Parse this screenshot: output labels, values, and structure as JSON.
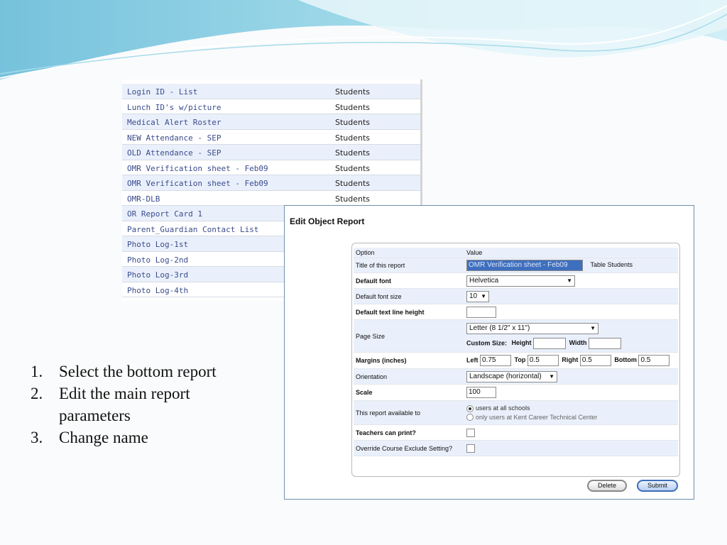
{
  "report_list": {
    "rows": [
      {
        "name": "Login ID - List",
        "category": "Students"
      },
      {
        "name": "Lunch ID's w/picture",
        "category": "Students"
      },
      {
        "name": "Medical Alert Roster",
        "category": "Students"
      },
      {
        "name": "NEW Attendance - SEP",
        "category": "Students"
      },
      {
        "name": "OLD Attendance - SEP",
        "category": "Students"
      },
      {
        "name": "OMR Verification sheet - Feb09",
        "category": "Students"
      },
      {
        "name": "OMR Verification sheet - Feb09",
        "category": "Students"
      },
      {
        "name": "OMR-DLB",
        "category": "Students"
      },
      {
        "name": "OR Report Card 1",
        "category": ""
      },
      {
        "name": "Parent_Guardian Contact List",
        "category": ""
      },
      {
        "name": "Photo Log-1st",
        "category": ""
      },
      {
        "name": "Photo Log-2nd",
        "category": ""
      },
      {
        "name": "Photo Log-3rd",
        "category": ""
      },
      {
        "name": "Photo Log-4th",
        "category": ""
      }
    ]
  },
  "instructions": [
    {
      "num": "1.",
      "text": "Select the bottom report"
    },
    {
      "num": "2.",
      "text": "Edit the main report parameters"
    },
    {
      "num": "3.",
      "text": "Change name"
    }
  ],
  "dialog": {
    "title": "Edit Object Report",
    "header_option": "Option",
    "header_value": "Value",
    "title_label": "Title of this report",
    "title_value": "OMR Verification sheet - Feb09",
    "table_text": "Table Students",
    "font_label": "Default font",
    "font_value": "Helvetica",
    "font_size_label": "Default font size",
    "font_size_value": "10",
    "line_height_label": "Default text line height",
    "line_height_value": "",
    "page_size_label": "Page Size",
    "page_size_value": "Letter (8 1/2\" x 11\")",
    "custom_size_label": "Custom Size:",
    "height_label": "Height",
    "height_value": "",
    "width_label": "Width",
    "width_value": "",
    "margins_label": "Margins (inches)",
    "left_label": "Left",
    "left_value": "0.75",
    "top_label": "Top",
    "top_value": "0.5",
    "right_label": "Right",
    "right_value": "0.5",
    "bottom_label": "Bottom",
    "bottom_value": "0.5",
    "orientation_label": "Orientation",
    "orientation_value": "Landscape (horizontal)",
    "scale_label": "Scale",
    "scale_value": "100",
    "available_label": "This report available to",
    "available_all": "users at all schools",
    "available_only": "only users at Kent Career Technical Center",
    "teachers_print_label": "Teachers can print?",
    "override_label": "Override Course Exclude Setting?",
    "delete_label": "Delete",
    "submit_label": "Submit"
  },
  "colors": {
    "link": "#3a4c8c",
    "row_shade": "#eaf0fb",
    "selection": "#3e6fbf",
    "dialog_border": "#6f8fb0"
  }
}
